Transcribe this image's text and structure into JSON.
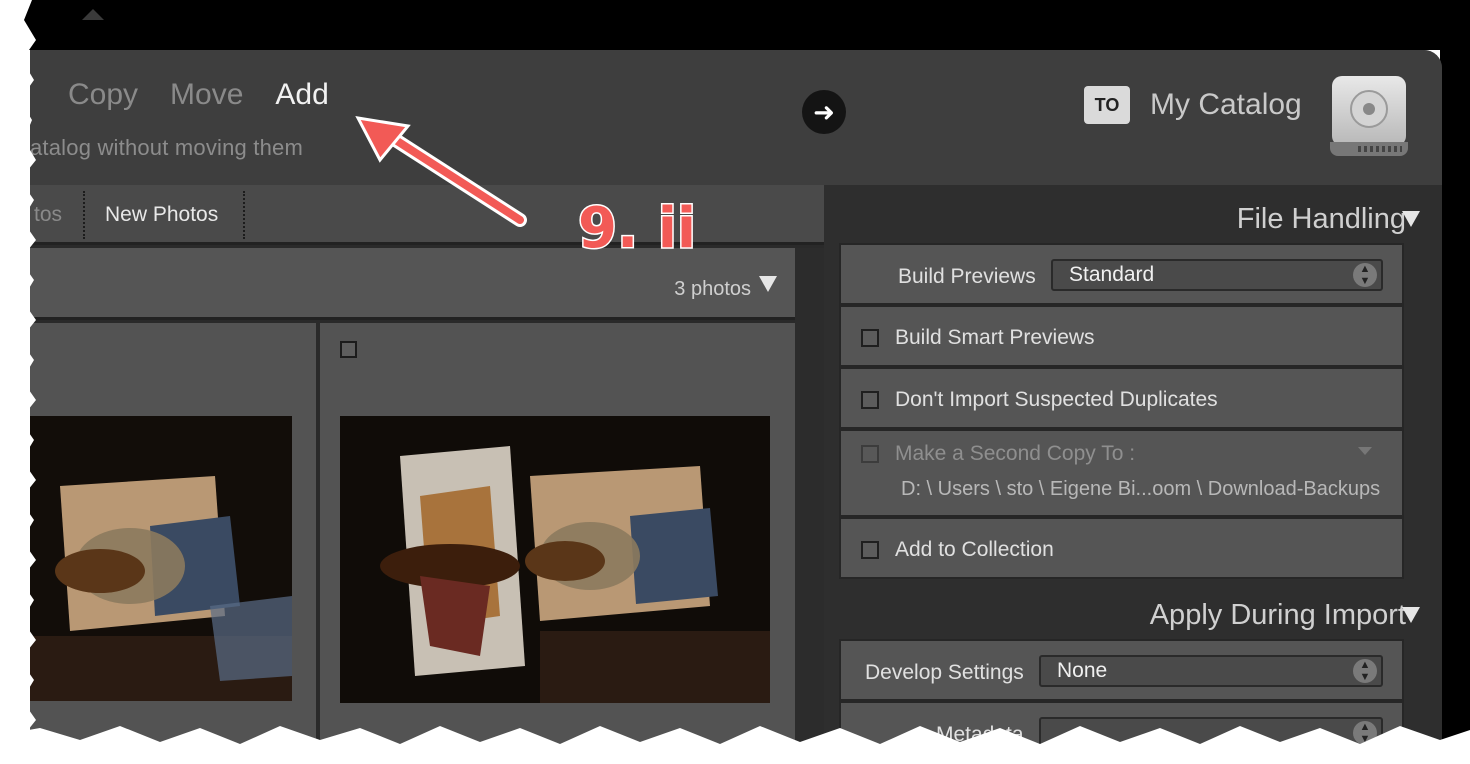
{
  "header": {
    "modes": [
      {
        "label": "Copy",
        "active": false
      },
      {
        "label": "Move",
        "active": false
      },
      {
        "label": "Add",
        "active": true
      }
    ],
    "subtitle": "atalog without moving them",
    "destination_badge": "TO",
    "destination_name": "My Catalog"
  },
  "left": {
    "tabs": [
      {
        "label": "tos",
        "active": false
      },
      {
        "label": "New Photos",
        "active": true
      }
    ],
    "photo_count": "3 photos"
  },
  "file_handling": {
    "title": "File Handling",
    "build_previews_label": "Build Previews",
    "build_previews_value": "Standard",
    "build_smart_previews": "Build Smart Previews",
    "dont_import_duplicates": "Don't Import Suspected Duplicates",
    "second_copy_label": "Make a Second Copy To :",
    "second_copy_path": "D: \\ Users \\ sto \\ Eigene Bi...oom \\ Download-Backups",
    "add_to_collection": "Add to Collection"
  },
  "apply_during_import": {
    "title": "Apply During Import",
    "develop_settings_label": "Develop Settings",
    "develop_settings_value": "None",
    "metadata_label": "Metadata"
  },
  "annotation": {
    "label": "9. ii",
    "color": "#f25a56"
  }
}
